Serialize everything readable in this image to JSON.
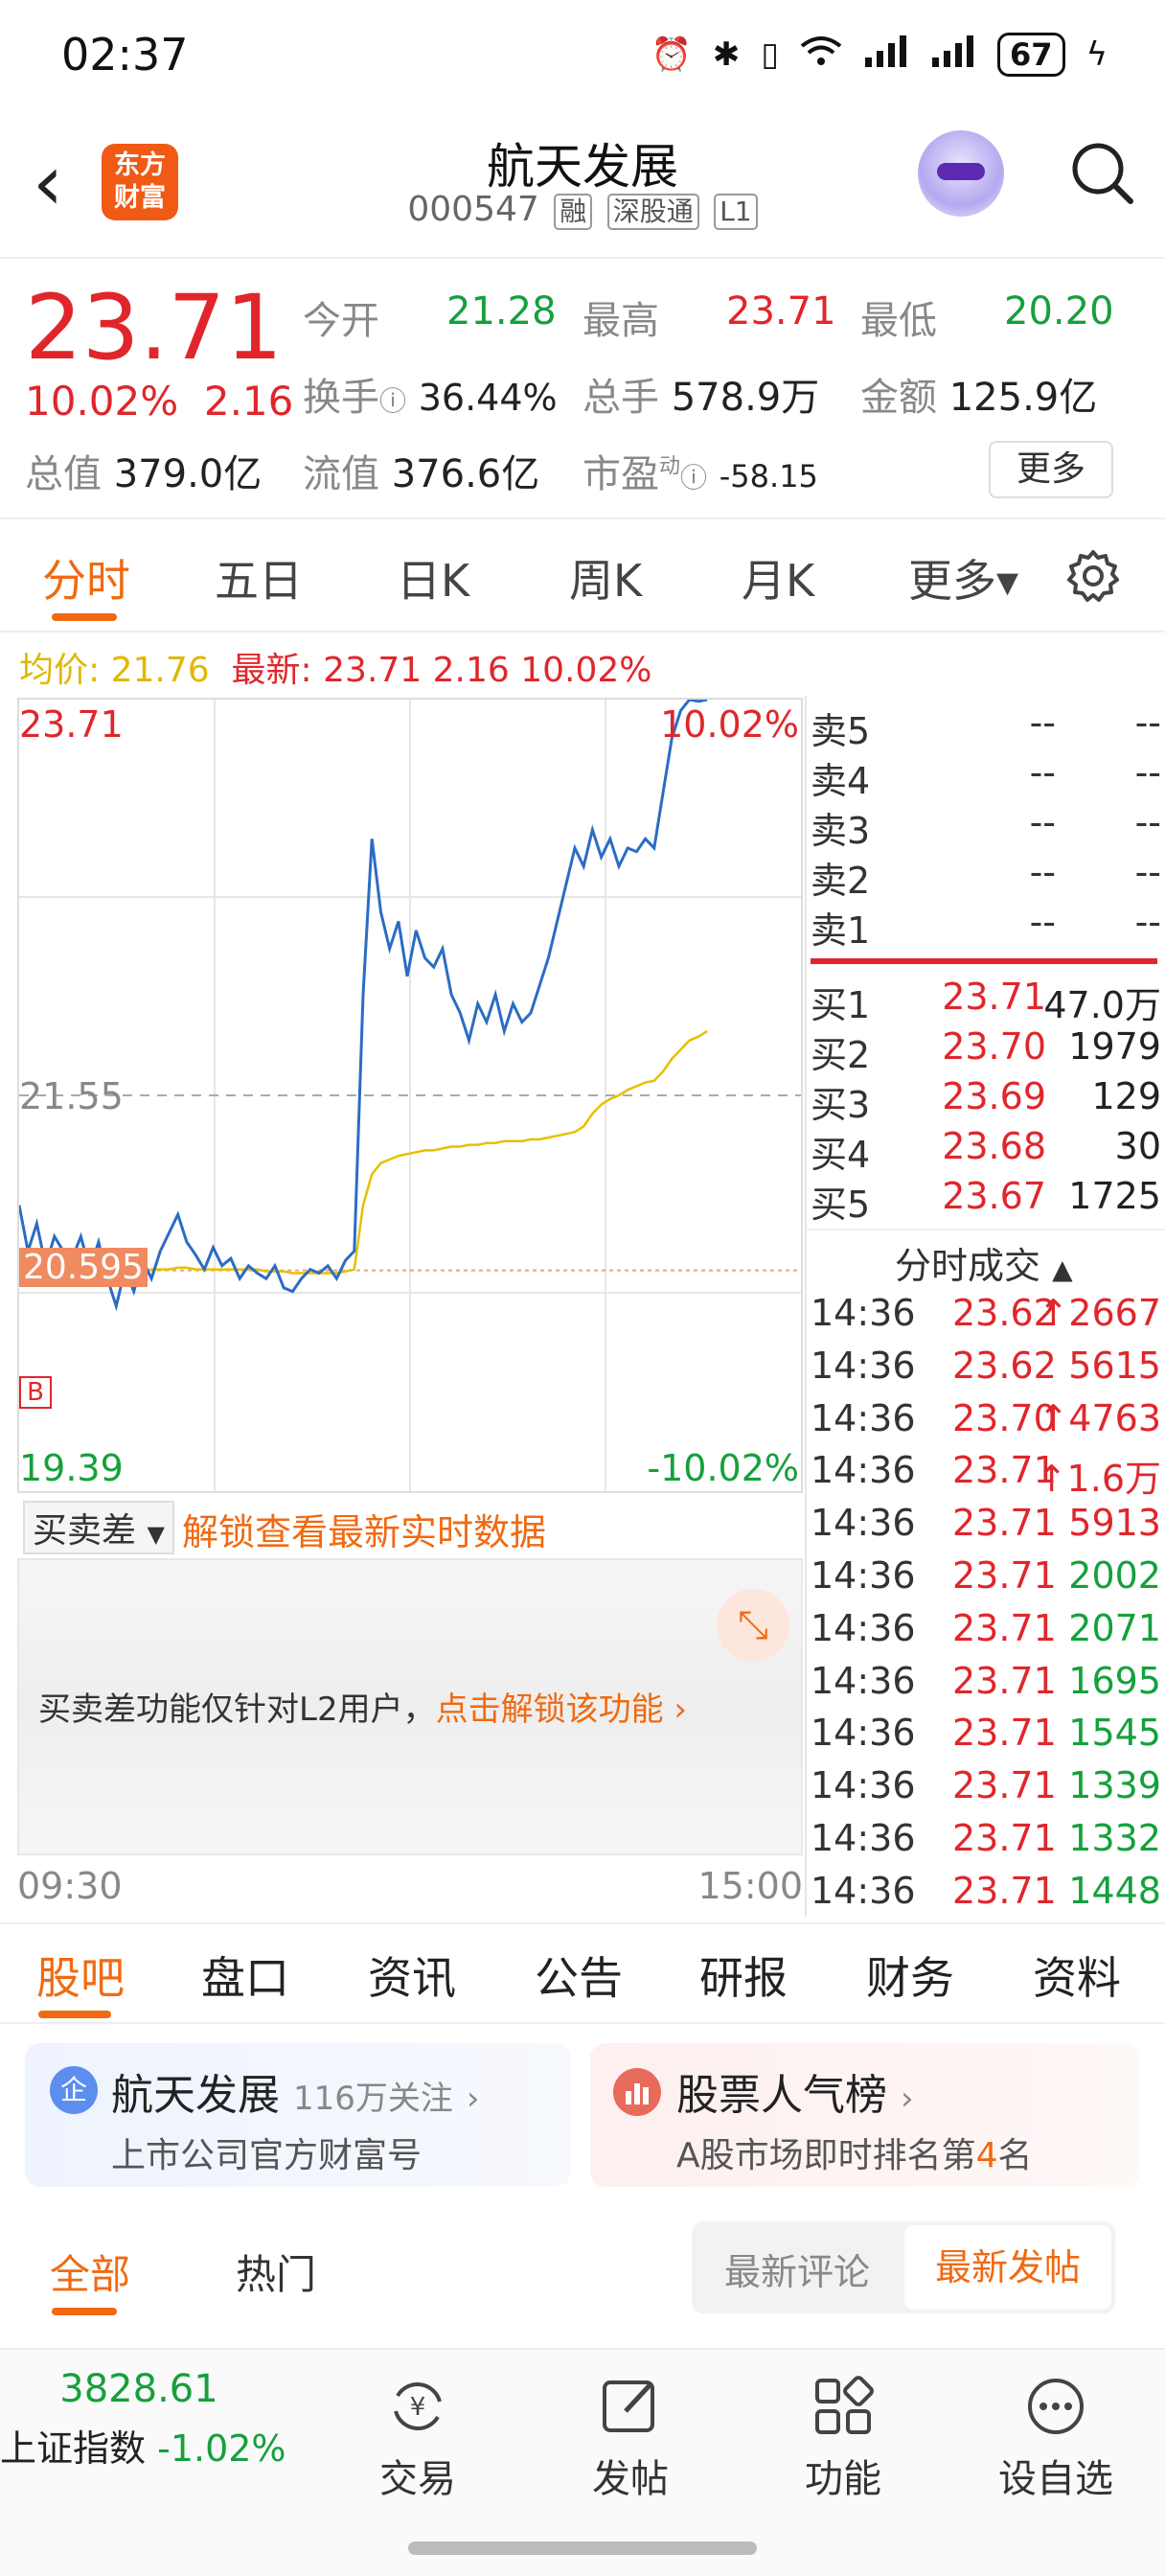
{
  "status_bar": {
    "time": "02:37",
    "battery": "67"
  },
  "header": {
    "logo_text_line1": "东方",
    "logo_text_line2": "财富",
    "title": "航天发展",
    "code": "000547",
    "tags": [
      "融",
      "深股通",
      "L1"
    ]
  },
  "quote": {
    "price": "23.71",
    "change_pct": "10.02%",
    "change": "2.16",
    "open_label": "今开",
    "open": "21.28",
    "high_label": "最高",
    "high": "23.71",
    "low_label": "最低",
    "low": "20.20",
    "turnover_label": "换手",
    "turnover": "36.44%",
    "volume_label": "总手",
    "volume": "578.9万",
    "amount_label": "金额",
    "amount": "125.9亿",
    "total_mv_label": "总值",
    "total_mv": "379.0亿",
    "float_mv_label": "流值",
    "float_mv": "376.6亿",
    "pe_label": "市盈",
    "pe_sup": "动",
    "pe": "-58.15",
    "more_button": "更多"
  },
  "chart_tabs": [
    "分时",
    "五日",
    "日K",
    "周K",
    "月K",
    "更多▾"
  ],
  "avg_line": {
    "avg_label": "均价:",
    "avg": "21.76",
    "latest_label": "最新:",
    "latest": "23.71 2.16 10.02%"
  },
  "intraday": {
    "y_top": "23.71",
    "y_mid": "21.55",
    "y_bottom": "19.39",
    "pct_top": "10.02%",
    "pct_bottom": "-10.02%",
    "prev_close_label": "20.595",
    "buy_marker": "B",
    "time_start": "09:30",
    "time_end": "15:00"
  },
  "chart_data": {
    "type": "line",
    "ylim": [
      19.39,
      23.71
    ],
    "series": [
      {
        "values": [
          20.95,
          20.7,
          20.85,
          20.62,
          20.78,
          20.7,
          20.66,
          20.78,
          20.6,
          20.75,
          20.55,
          20.4,
          20.6,
          20.48,
          20.65,
          20.55,
          20.7,
          20.8,
          20.9,
          20.75,
          20.68,
          20.6,
          20.72,
          20.62,
          20.66,
          20.55,
          20.62,
          20.58,
          20.55,
          20.62,
          20.5,
          20.48,
          20.55,
          20.6,
          20.58,
          20.62,
          20.55,
          20.65,
          20.7,
          22.1,
          22.95,
          22.55,
          22.35,
          22.5,
          22.2,
          22.45,
          22.3,
          22.25,
          22.35,
          22.1,
          22.0,
          21.85,
          22.05,
          21.95,
          22.1,
          21.9,
          22.05,
          21.95,
          22.0,
          22.15,
          22.3,
          22.5,
          22.7,
          22.9,
          22.8,
          23.0,
          22.85,
          22.95,
          22.8,
          22.9,
          22.88,
          22.95,
          22.9,
          23.2,
          23.5,
          23.65,
          23.71,
          23.7,
          23.71
        ]
      },
      {
        "values": [
          20.62,
          20.6,
          20.6,
          20.61,
          20.6,
          20.6,
          20.59,
          20.6,
          20.6,
          20.59,
          20.6,
          20.59,
          20.58,
          20.58,
          20.59,
          20.6,
          20.6,
          20.6,
          20.61,
          20.61,
          20.6,
          20.6,
          20.6,
          20.6,
          20.6,
          20.6,
          20.6,
          20.6,
          20.59,
          20.59,
          20.59,
          20.58,
          20.58,
          20.58,
          20.58,
          20.58,
          20.58,
          20.59,
          20.6,
          20.95,
          21.12,
          21.18,
          21.2,
          21.22,
          21.23,
          21.24,
          21.25,
          21.25,
          21.26,
          21.27,
          21.27,
          21.28,
          21.28,
          21.29,
          21.29,
          21.3,
          21.3,
          21.3,
          21.31,
          21.31,
          21.32,
          21.33,
          21.34,
          21.35,
          21.38,
          21.45,
          21.5,
          21.53,
          21.55,
          21.58,
          21.6,
          21.62,
          21.63,
          21.68,
          21.75,
          21.8,
          21.85,
          21.87,
          21.9
        ]
      }
    ]
  },
  "order_book": {
    "asks": [
      {
        "label": "卖5",
        "price": "--",
        "vol": "--"
      },
      {
        "label": "卖4",
        "price": "--",
        "vol": "--"
      },
      {
        "label": "卖3",
        "price": "--",
        "vol": "--"
      },
      {
        "label": "卖2",
        "price": "--",
        "vol": "--"
      },
      {
        "label": "卖1",
        "price": "--",
        "vol": "--"
      }
    ],
    "bids": [
      {
        "label": "买1",
        "price": "23.71",
        "vol": "47.0万"
      },
      {
        "label": "买2",
        "price": "23.70",
        "vol": "1979"
      },
      {
        "label": "买3",
        "price": "23.69",
        "vol": "129"
      },
      {
        "label": "买4",
        "price": "23.68",
        "vol": "30"
      },
      {
        "label": "买5",
        "price": "23.67",
        "vol": "1725"
      }
    ],
    "trades_title": "分时成交",
    "trades": [
      {
        "time": "14:36",
        "price": "23.62",
        "vol": "↑2667",
        "color": "red"
      },
      {
        "time": "14:36",
        "price": "23.62",
        "vol": "5615",
        "color": "red"
      },
      {
        "time": "14:36",
        "price": "23.70",
        "vol": "↑4763",
        "color": "red"
      },
      {
        "time": "14:36",
        "price": "23.71",
        "vol": "↑1.6万",
        "color": "red"
      },
      {
        "time": "14:36",
        "price": "23.71",
        "vol": "5913",
        "color": "red"
      },
      {
        "time": "14:36",
        "price": "23.71",
        "vol": "2002",
        "color": "green"
      },
      {
        "time": "14:36",
        "price": "23.71",
        "vol": "2071",
        "color": "green"
      },
      {
        "time": "14:36",
        "price": "23.71",
        "vol": "1695",
        "color": "green"
      },
      {
        "time": "14:36",
        "price": "23.71",
        "vol": "1545",
        "color": "green"
      },
      {
        "time": "14:36",
        "price": "23.71",
        "vol": "1339",
        "color": "green"
      },
      {
        "time": "14:36",
        "price": "23.71",
        "vol": "1332",
        "color": "green"
      },
      {
        "time": "14:36",
        "price": "23.71",
        "vol": "1448",
        "color": "green"
      }
    ]
  },
  "sub_panel": {
    "selector": "买卖差",
    "unlock_link": "解锁查看最新实时数据",
    "notice": "买卖差功能仅针对L2用户，",
    "notice_link": "点击解锁该功能"
  },
  "bottom_tabs": [
    "股吧",
    "盘口",
    "资讯",
    "公告",
    "研报",
    "财务",
    "资料"
  ],
  "cards": {
    "left_title": "航天发展",
    "left_badge": "116万关注",
    "left_sub": "上市公司官方财富号",
    "left_icon": "企",
    "right_title": "股票人气榜",
    "right_sub_prefix": "A股市场即时排名第",
    "right_rank": "4",
    "right_sub_suffix": "名"
  },
  "filter": {
    "all": "全部",
    "hot": "热门",
    "latest_comment": "最新评论",
    "latest_post": "最新发帖"
  },
  "bottom_nav": {
    "index_value": "3828.61",
    "index_name": "上证指数",
    "index_change": "-1.02%",
    "trade": "交易",
    "post": "发帖",
    "functions": "功能",
    "watchlist": "设自选"
  },
  "colors": {
    "accent": "#f06a12",
    "up": "#e0262b",
    "down": "#15a03c",
    "price_line": "#2b6cc4",
    "avg_line": "#e6c000"
  }
}
